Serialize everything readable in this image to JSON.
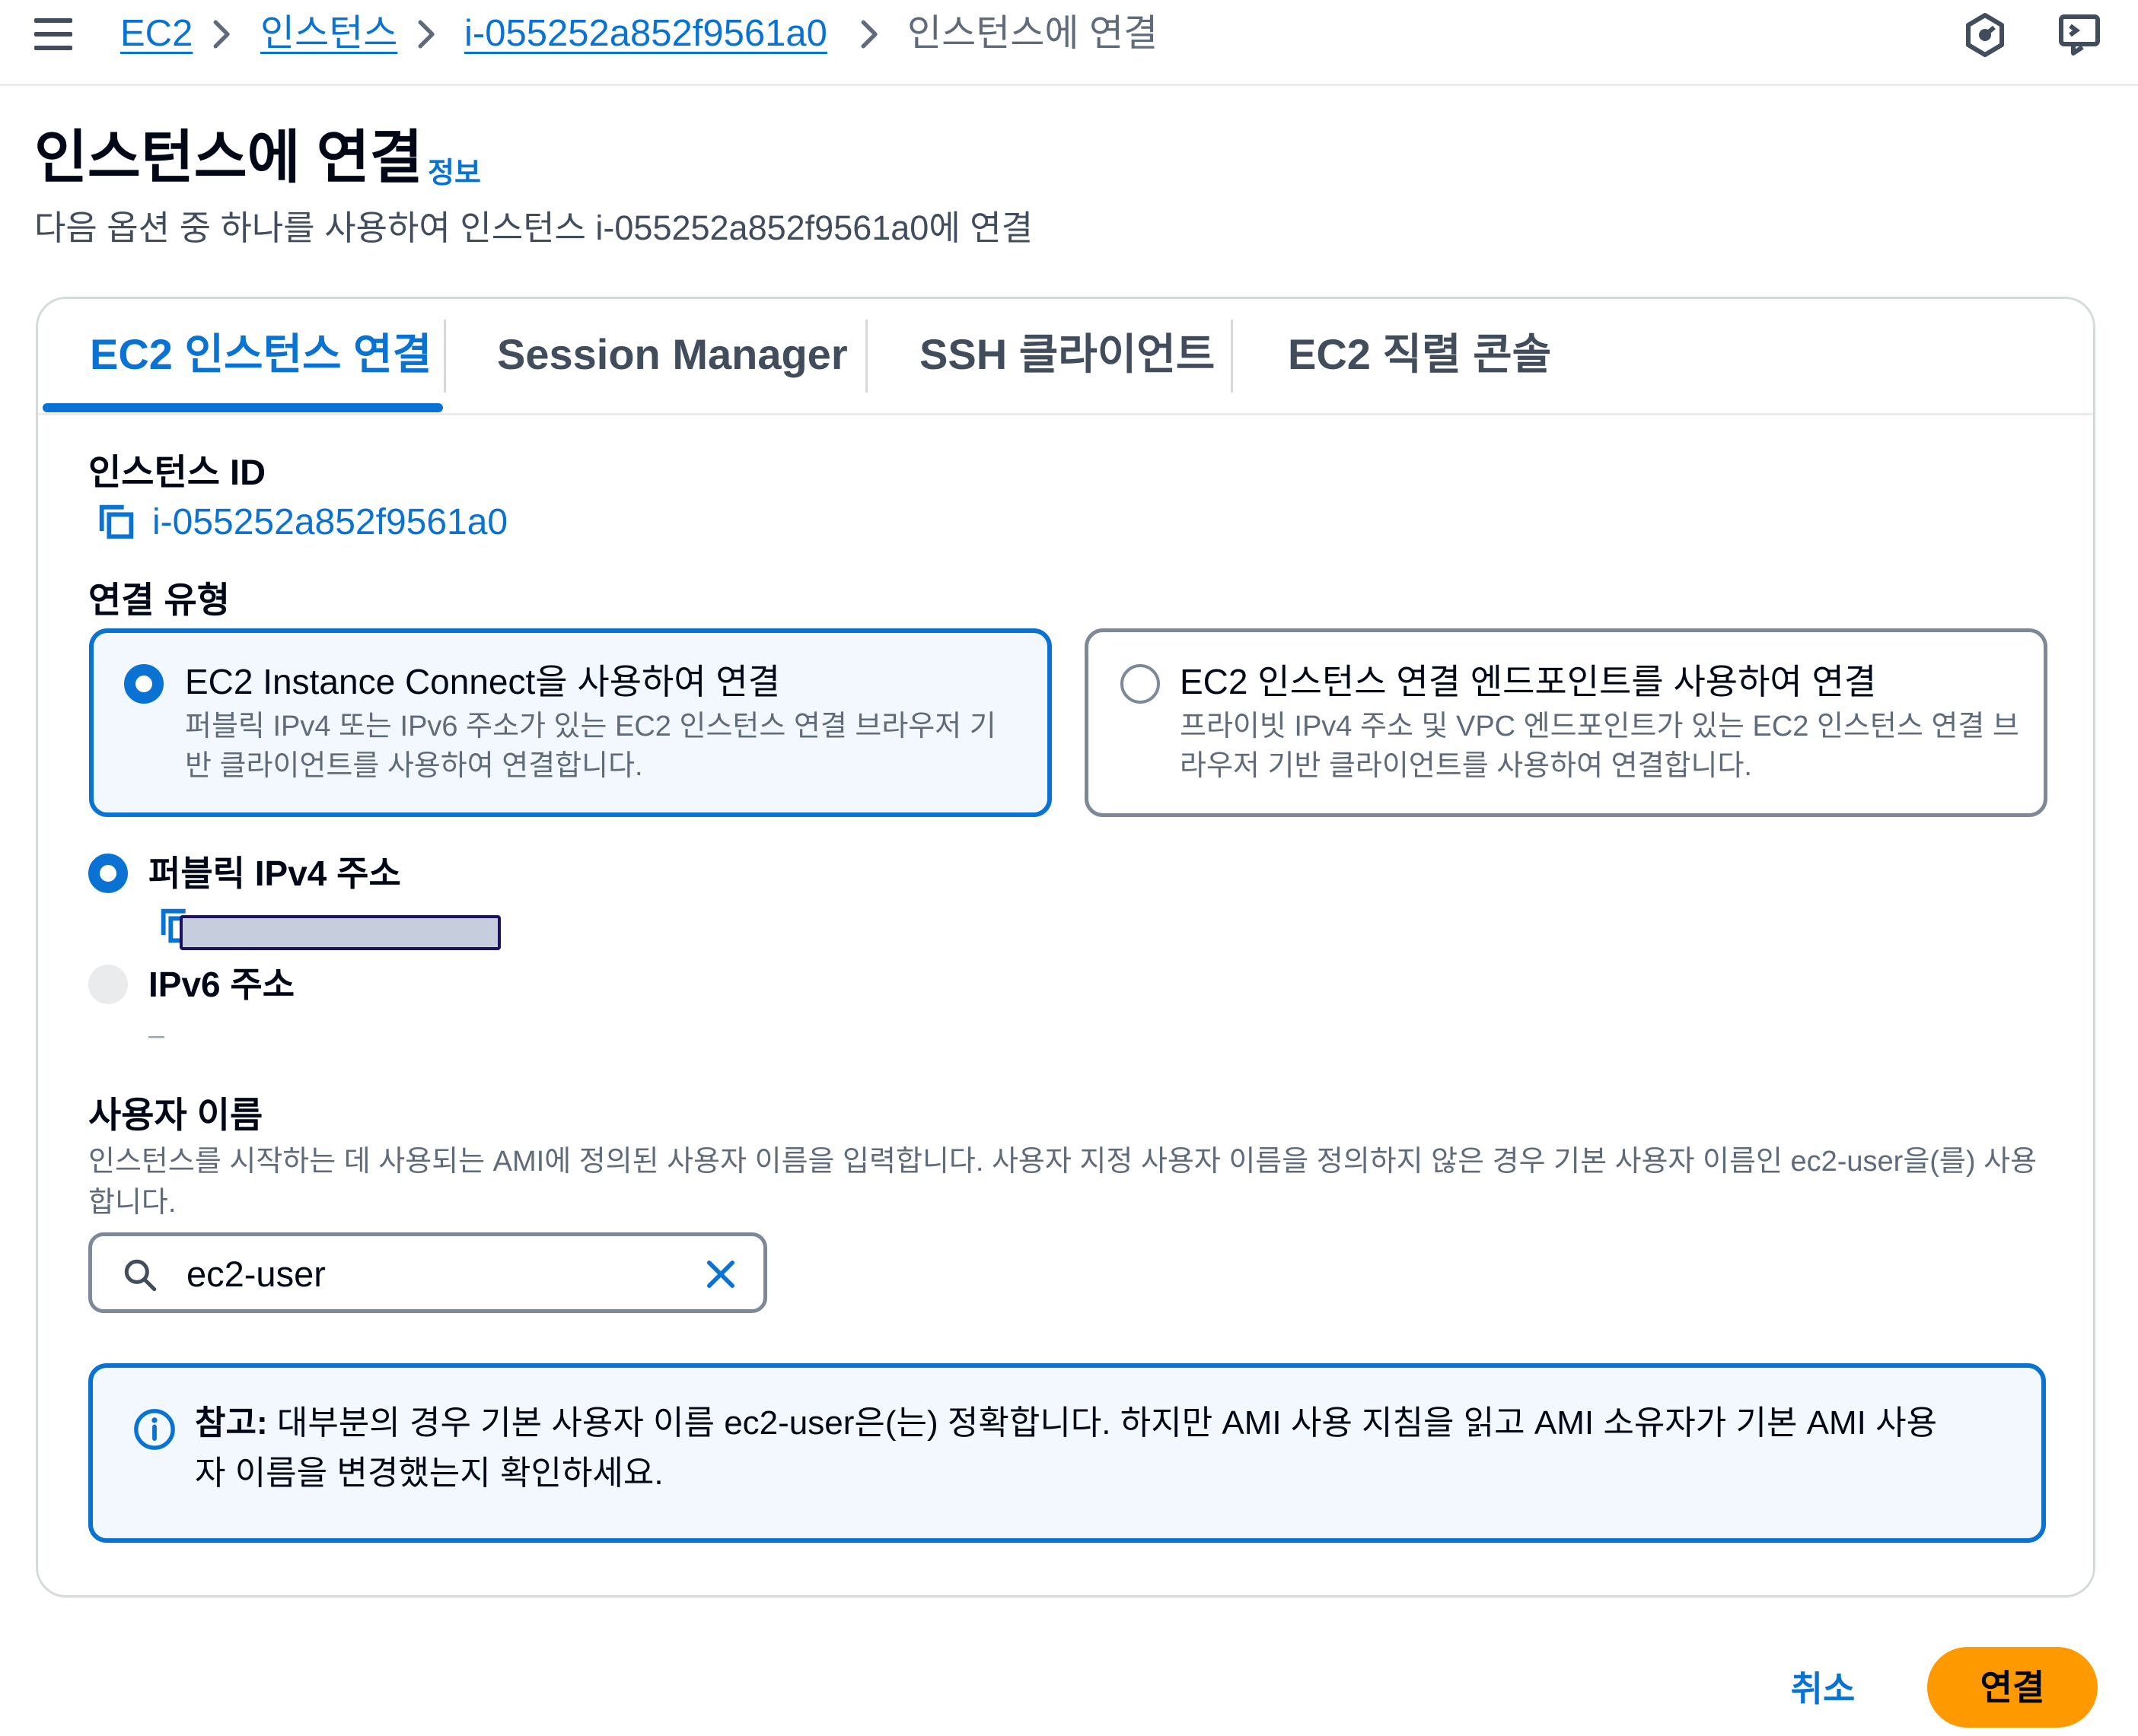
{
  "breadcrumb": {
    "items": [
      "EC2",
      "인스턴스",
      "i-055252a852f9561a0"
    ],
    "current": "인스턴스에 연결"
  },
  "header": {
    "title": "인스턴스에 연결",
    "info": "정보",
    "description": "다음 옵션 중 하나를 사용하여 인스턴스 i-055252a852f9561a0에 연결"
  },
  "tabs": [
    {
      "label": "EC2 인스턴스 연결",
      "active": true
    },
    {
      "label": "Session Manager",
      "active": false
    },
    {
      "label": "SSH 클라이언트",
      "active": false
    },
    {
      "label": "EC2 직렬 콘솔",
      "active": false
    }
  ],
  "instance": {
    "label": "인스턴스 ID",
    "id": "i-055252a852f9561a0"
  },
  "connection_type": {
    "label": "연결 유형",
    "options": [
      {
        "title": "EC2 Instance Connect을 사용하여 연결",
        "desc_line1": "퍼블릭 IPv4 또는 IPv6 주소가 있는 EC2 인스턴스 연결 브라우저 기",
        "desc_line2": "반 클라이언트를 사용하여 연결합니다.",
        "selected": true
      },
      {
        "title": "EC2 인스턴스 연결 엔드포인트를 사용하여 연결",
        "desc_line1": "프라이빗 IPv4 주소 및 VPC 엔드포인트가 있는 EC2 인스턴스 연결 브",
        "desc_line2": "라우저 기반 클라이언트를 사용하여 연결합니다.",
        "selected": false
      }
    ]
  },
  "ip": {
    "ipv4_label": "퍼블릭 IPv4 주소",
    "ipv6_label": "IPv6 주소",
    "ipv6_value": "–"
  },
  "username": {
    "label": "사용자 이름",
    "desc_line1": "인스턴스를 시작하는 데 사용되는 AMI에 정의된 사용자 이름을 입력합니다. 사용자 지정 사용자 이름을 정의하지 않은 경우 기본 사용자 이름인 ec2-user을(를) 사용",
    "desc_line2": "합니다.",
    "value": "ec2-user"
  },
  "alert": {
    "prefix": "참고:",
    "line1": " 대부분의 경우 기본 사용자 이름 ec2-user은(는) 정확합니다. 하지만 AMI 사용 지침을 읽고 AMI 소유자가 기본 AMI 사용",
    "line2": "자 이름을 변경했는지 확인하세요."
  },
  "actions": {
    "cancel": "취소",
    "connect": "연결"
  },
  "colors": {
    "link": "#0972d3",
    "primary_button": "#ff9900",
    "selected_tile_bg": "#f2f8fd"
  }
}
